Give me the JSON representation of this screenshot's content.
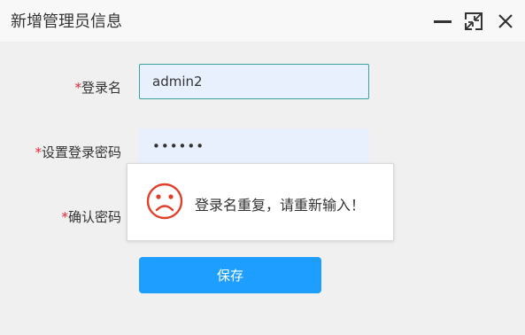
{
  "dialog": {
    "title": "新增管理员信息",
    "controls": {
      "minimize_icon": "minimize-icon",
      "maximize_icon": "maximize-icon",
      "close_icon": "close-icon"
    }
  },
  "form": {
    "required_mark": "*",
    "username": {
      "label": "登录名",
      "value": "admin2"
    },
    "password": {
      "label": "设置登录密码",
      "value": "••••••"
    },
    "confirm_password": {
      "label": "确认密码",
      "value": ""
    },
    "save_label": "保存"
  },
  "toast": {
    "icon": "sad-face-icon",
    "message": "登录名重复，请重新输入！"
  },
  "colors": {
    "primary_button": "#1e9fff",
    "required": "#e0283a",
    "focus_border": "#3aa59a",
    "toast_icon": "#e0402a"
  }
}
